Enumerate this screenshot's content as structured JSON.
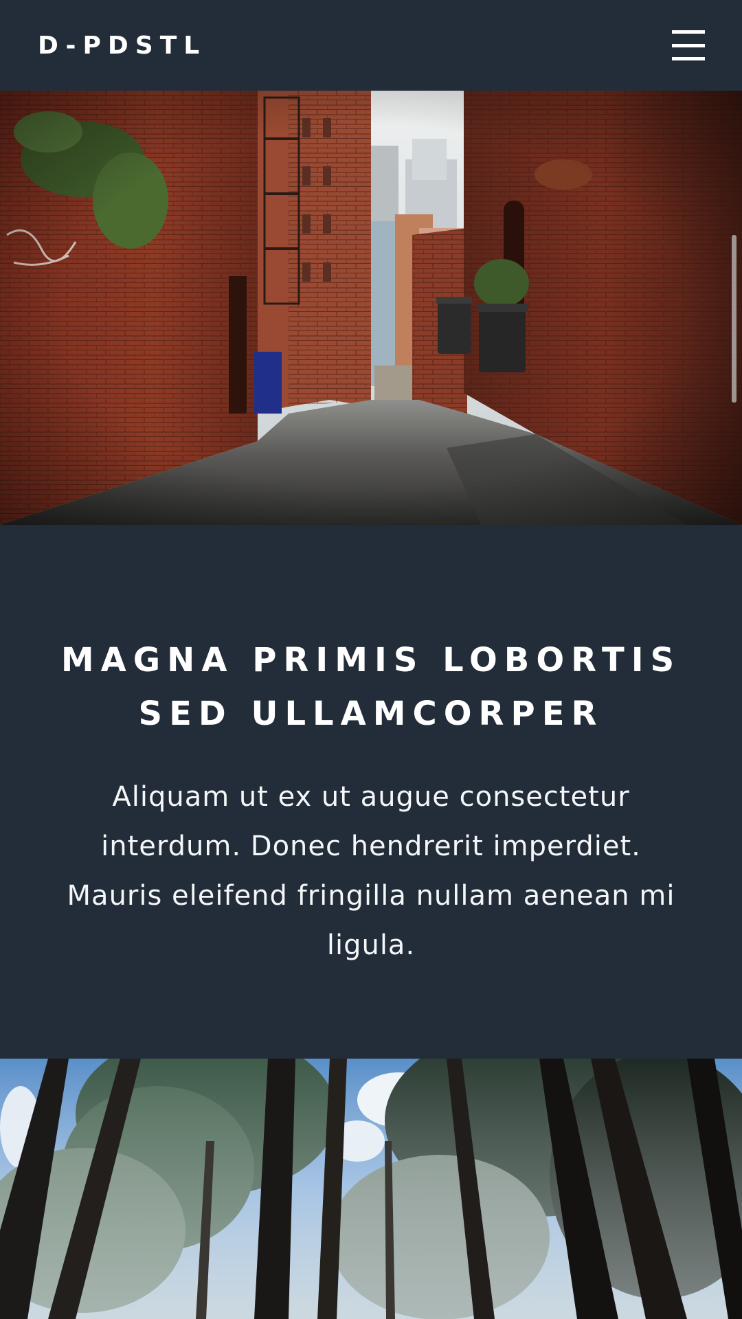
{
  "header": {
    "logo": "D-PDSTL",
    "menu_icon": "hamburger-menu-icon"
  },
  "hero_image": {
    "subject": "city-alley-photo"
  },
  "banner": {
    "title": "Magna primis lobortis sed ullamcorper",
    "text": "Aliquam ut ex ut augue consectetur interdum. Donec hendrerit imperdiet. Mauris eleifend fringilla nullam aenean mi ligula."
  },
  "second_image": {
    "subject": "forest-photo"
  },
  "colors": {
    "background": "#222d39",
    "text": "#ffffff",
    "brick": "#8a3a26"
  }
}
